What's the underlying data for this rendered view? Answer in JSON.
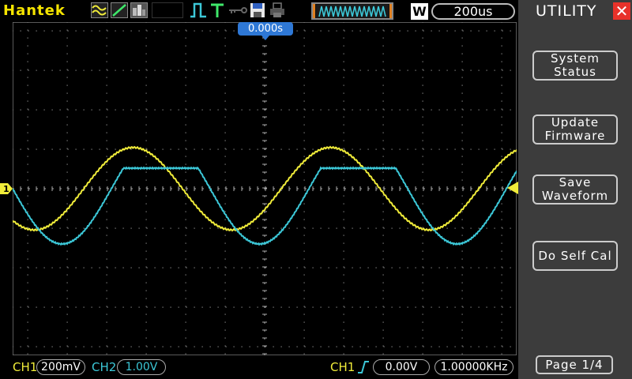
{
  "header": {
    "brand": "Hantek",
    "timebase": "200us",
    "timebase_mode": "W",
    "trigger_position": "0.000s",
    "icons": [
      "wave-display-icon",
      "xy-mode-icon",
      "persistence-icon",
      "pulse-icon",
      "trigger-t-icon",
      "key-icon",
      "save-icon",
      "print-icon",
      "memory-window-icon"
    ]
  },
  "sidebar": {
    "title": "UTILITY",
    "buttons": [
      {
        "line1": "System",
        "line2": "Status"
      },
      {
        "line1": "Update",
        "line2": "Firmware"
      },
      {
        "line1": "Save",
        "line2": "Waveform"
      },
      {
        "line1": "Do Self Cal",
        "line2": ""
      }
    ],
    "page": "Page 1/4"
  },
  "footer": {
    "ch1_label": "CH1",
    "ch1_scale": "200mV",
    "ch2_label": "CH2",
    "ch2_scale": "1.00V",
    "trig_source": "CH1",
    "trig_level": "0.00V",
    "frequency": "1.00000KHz"
  },
  "colors": {
    "ch1": "#f0ec3a",
    "ch2": "#3cc8d8",
    "accent": "#2e78d6",
    "sidebar": "#3c3c3c"
  },
  "chart_data": {
    "type": "line",
    "series": [
      {
        "name": "CH1",
        "shape": "sine",
        "period_divs": 5,
        "amplitude_divs": 1.1
      },
      {
        "name": "CH2",
        "shape": "clipped-sine",
        "period_divs": 5,
        "amplitude_divs": 1.0
      }
    ],
    "grid": true,
    "xlim": [
      -6.5,
      6.5
    ],
    "ylim": [
      -4.3,
      4.3
    ]
  }
}
